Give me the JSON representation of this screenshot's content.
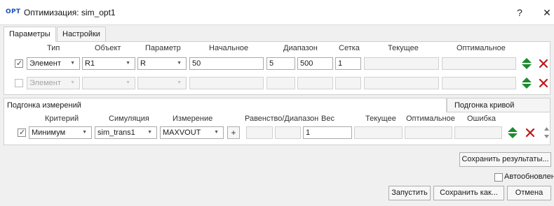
{
  "window": {
    "logo": "OPT",
    "title": "Оптимизация: sim_opt1",
    "help_label": "?",
    "close_label": "✕"
  },
  "tabs": [
    {
      "label": "Параметры",
      "active": true
    },
    {
      "label": "Настройки",
      "active": false
    }
  ],
  "params": {
    "headers": {
      "type": "Тип",
      "object": "Объект",
      "parameter": "Параметр",
      "start": "Начальное",
      "range": "Диапазон",
      "grid": "Сетка",
      "current": "Текущее",
      "optimal": "Оптимальное"
    },
    "rows": [
      {
        "checked": true,
        "type": "Элемент",
        "object": "R1",
        "parameter": "R",
        "start": "50",
        "range_min": "5",
        "range_max": "500",
        "grid": "1",
        "current": "",
        "optimal": ""
      },
      {
        "checked": false,
        "type": "Элемент",
        "object": "",
        "parameter": "",
        "start": "",
        "range_min": "",
        "range_max": "",
        "grid": "",
        "current": "",
        "optimal": ""
      }
    ]
  },
  "measurements": {
    "title": "Подгонка измерений",
    "curve_tab": "Подгонка кривой",
    "headers": {
      "criterion": "Критерий",
      "simulation": "Симуляция",
      "measurement": "Измерение",
      "equality": "Равенство/Диапазон",
      "weight": "Вес",
      "current": "Текущее",
      "optimal": "Оптимальное",
      "error": "Ошибка"
    },
    "row": {
      "checked": true,
      "criterion": "Минимум",
      "simulation": "sim_trans1",
      "measurement": "MAXVOUT",
      "add_label": "+",
      "eq_a": "",
      "eq_b": "",
      "weight": "1",
      "current": "",
      "optimal": "",
      "error": ""
    }
  },
  "footer": {
    "save_results": "Сохранить результаты...",
    "auto_update": "Автообновление",
    "auto_update_checked": false,
    "run": "Запустить",
    "save_as": "Сохранить как...",
    "cancel": "Отмена"
  },
  "icons": {
    "move_color": "#1e8a2e",
    "delete_color": "#c0161a"
  }
}
